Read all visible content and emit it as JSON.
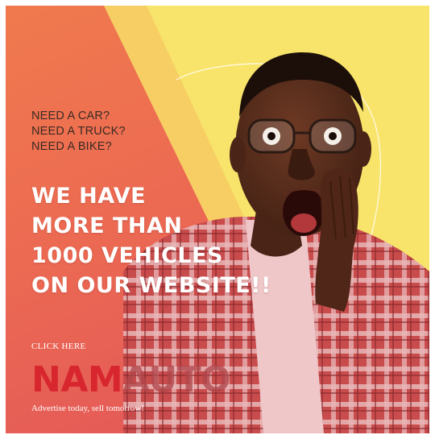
{
  "ad": {
    "questions": [
      "NEED A CAR?",
      "NEED A TRUCK?",
      "NEED A BIKE?"
    ],
    "headline": [
      "WE HAVE",
      "MORE THAN",
      "1000 VEHICLES",
      "ON OUR WEBSITE!!"
    ],
    "cta": "CLICK HERE",
    "logo": {
      "part1": "NAM",
      "part2": "AUTO"
    },
    "tagline": "Advertise today, sell tomorrow!"
  },
  "colors": {
    "yellow_bg": "#f8e46a",
    "orange_gradient_top": "#f07a4e",
    "orange_gradient_bottom": "#e55c57",
    "logo_red": "#d8262e",
    "shirt_plaid": "#c94c4c",
    "tshirt": "#efc7c9"
  },
  "photo": {
    "subject": "surprised-man-photo"
  }
}
